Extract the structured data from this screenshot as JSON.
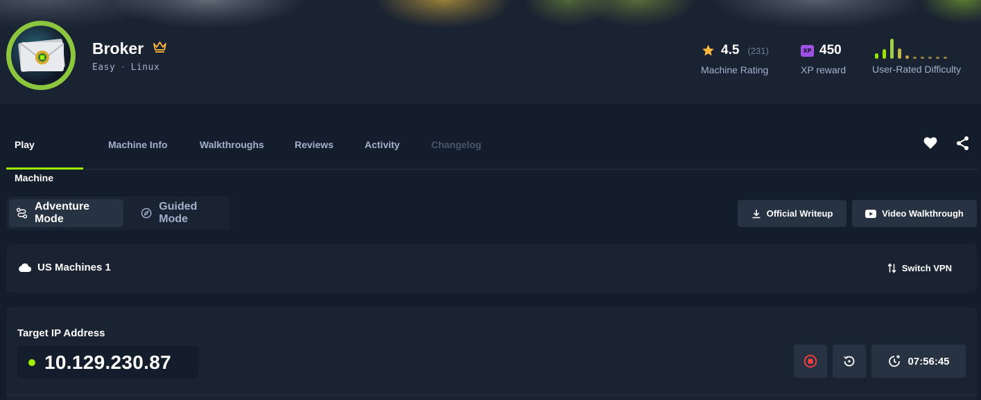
{
  "machine": {
    "name": "Broker",
    "difficulty": "Easy",
    "separator": "·",
    "os": "Linux"
  },
  "stats": {
    "rating_value": "4.5",
    "rating_count": "(231)",
    "rating_label": "Machine Rating",
    "xp_badge": "XP",
    "xp_value": "450",
    "xp_label": "XP reward",
    "difficulty_label": "User-Rated Difficulty",
    "difficulty_distribution": [
      0.25,
      0.45,
      0.95,
      0.5,
      0.15,
      0.08,
      0.08,
      0.08,
      0.08,
      0.08
    ]
  },
  "tabs": [
    {
      "label": "Play Machine",
      "state": "active"
    },
    {
      "label": "Machine Info",
      "state": "normal"
    },
    {
      "label": "Walkthroughs",
      "state": "normal"
    },
    {
      "label": "Reviews",
      "state": "normal"
    },
    {
      "label": "Activity",
      "state": "normal"
    },
    {
      "label": "Changelog",
      "state": "disabled"
    }
  ],
  "modes": {
    "adventure": "Adventure Mode",
    "guided": "Guided Mode"
  },
  "actions": {
    "writeup": "Official Writeup",
    "video": "Video Walkthrough"
  },
  "vpn": {
    "server": "US Machines 1",
    "switch_label": "Switch VPN"
  },
  "target": {
    "label": "Target IP Address",
    "ip": "10.129.230.87",
    "timer": "07:56:45"
  },
  "colors": {
    "accent_green": "#9fef00",
    "ring_green": "#8cc63f",
    "star": "#ffb83b",
    "xp_purple": "#9f52e3",
    "stop_red": "#ff3e3e",
    "bg_dark": "#141d2b",
    "panel": "#1a2332"
  },
  "icons": [
    "crown-icon",
    "star-icon",
    "xp-icon",
    "heart-icon",
    "share-icon",
    "adventure-icon",
    "compass-icon",
    "download-icon",
    "youtube-icon",
    "cloud-icon",
    "swap-icon",
    "stop-icon",
    "reset-icon",
    "extend-time-icon"
  ]
}
